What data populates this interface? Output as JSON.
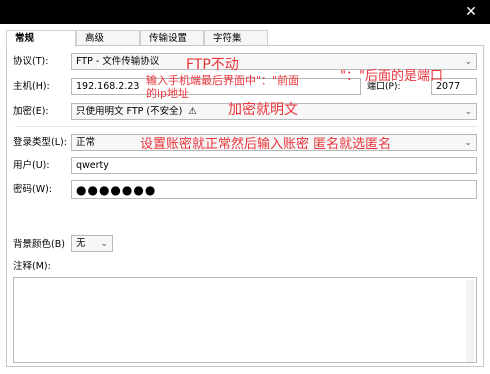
{
  "tabs": [
    {
      "label": "常规"
    },
    {
      "label": "高级"
    },
    {
      "label": "传输设置"
    },
    {
      "label": "字符集"
    }
  ],
  "form": {
    "protocol_label": "协议(T):",
    "protocol_value": "FTP - 文件传输协议",
    "host_label": "主机(H):",
    "host_value": "192.168.2.23",
    "port_label": "端口(P):",
    "port_value": "2077",
    "encryption_label": "加密(E):",
    "encryption_value": "只使用明文 FTP (不安全)",
    "login_type_label": "登录类型(L):",
    "login_type_value": "正常",
    "user_label": "用户(U):",
    "user_value": "qwerty",
    "password_label": "密码(W):",
    "password_value": "●●●●●●●",
    "bgcolor_label": "背景颜色(B)",
    "bgcolor_value": "无",
    "comment_label": "注释(M):"
  },
  "annotations": {
    "ftp_fixed": "FTP不动",
    "port_note": "\"：\"后面的是端口",
    "host_note_line1": "输入手机端最后界面中\"：\"前面",
    "host_note_line2": "的ip地址",
    "encrypt_note": "加密就明文",
    "login_note": "设置账密就正常然后输入账密   匿名就选匿名"
  },
  "colors": {
    "annotation": "#e8343a",
    "titlebar": "#000000"
  }
}
